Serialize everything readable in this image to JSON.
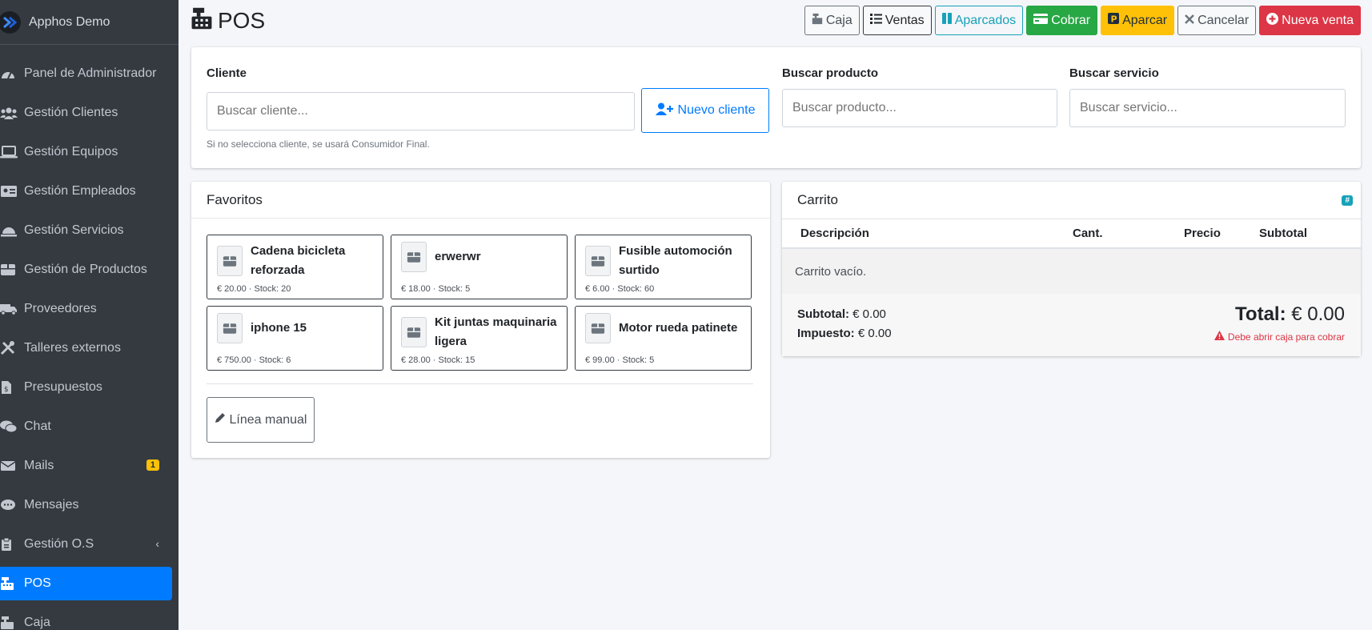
{
  "brand": {
    "name": "Apphos Demo"
  },
  "sidebar": {
    "items": [
      {
        "label": "Panel de Administrador",
        "icon": "tachometer-icon"
      },
      {
        "label": "Gestión Clientes",
        "icon": "users-icon"
      },
      {
        "label": "Gestión Equipos",
        "icon": "laptop-icon"
      },
      {
        "label": "Gestión Empleados",
        "icon": "id-card-icon"
      },
      {
        "label": "Gestión Servicios",
        "icon": "concierge-bell-icon"
      },
      {
        "label": "Gestión de Productos",
        "icon": "box-icon"
      },
      {
        "label": "Proveedores",
        "icon": "truck-icon"
      },
      {
        "label": "Talleres externos",
        "icon": "tools-icon"
      },
      {
        "label": "Presupuestos",
        "icon": "file-invoice-icon"
      },
      {
        "label": "Chat",
        "icon": "comments-icon"
      },
      {
        "label": "Mails",
        "icon": "envelope-icon",
        "badge": "1"
      },
      {
        "label": "Mensajes",
        "icon": "comment-dots-icon"
      },
      {
        "label": "Gestión O.S",
        "icon": "clipboard-icon"
      },
      {
        "label": "POS",
        "icon": "cash-register-icon",
        "active": true
      },
      {
        "label": "Caja",
        "icon": "cash-register-icon"
      }
    ]
  },
  "header": {
    "title": "POS",
    "buttons": {
      "caja": "Caja",
      "ventas": "Ventas",
      "aparcados": "Aparcados",
      "cobrar": "Cobrar",
      "aparcar": "Aparcar",
      "cancelar": "Cancelar",
      "nueva_venta": "Nueva venta"
    }
  },
  "search": {
    "cliente_label": "Cliente",
    "cliente_placeholder": "Buscar cliente...",
    "nuevo_cliente": "Nuevo cliente",
    "cliente_hint": "Si no selecciona cliente, se usará Consumidor Final.",
    "producto_label": "Buscar producto",
    "producto_placeholder": "Buscar producto...",
    "servicio_label": "Buscar servicio",
    "servicio_placeholder": "Buscar servicio..."
  },
  "favoritos": {
    "title": "Favoritos",
    "items": [
      {
        "name": "Cadena bicicleta reforzada",
        "meta": "€ 20.00 · Stock: 20"
      },
      {
        "name": "erwerwr",
        "meta": "€ 18.00 · Stock: 5"
      },
      {
        "name": "Fusible automoción surtido",
        "meta": "€ 6.00 · Stock: 60"
      },
      {
        "name": "iphone 15",
        "meta": "€ 750.00 · Stock: 6"
      },
      {
        "name": "Kit juntas maquinaria ligera",
        "meta": "€ 28.00 · Stock: 15"
      },
      {
        "name": "Motor rueda patinete",
        "meta": "€ 99.00 · Stock: 5"
      }
    ],
    "manual_label": "Línea manual"
  },
  "carrito": {
    "title": "Carrito",
    "badge": "#",
    "columns": {
      "descripcion": "Descripción",
      "cant": "Cant.",
      "precio": "Precio",
      "subtotal": "Subtotal"
    },
    "empty": "Carrito vacío.",
    "subtotal_label": "Subtotal:",
    "subtotal_value": "€ 0.00",
    "impuesto_label": "Impuesto:",
    "impuesto_value": "€ 0.00",
    "total_label": "Total:",
    "total_value": "€ 0.00",
    "warning": "Debe abrir caja para cobrar"
  },
  "colors": {
    "primary": "#007bff",
    "success": "#28a745",
    "warning": "#ffc107",
    "danger": "#dc3545",
    "info": "#17a2b8",
    "sidebar": "#343a40"
  }
}
